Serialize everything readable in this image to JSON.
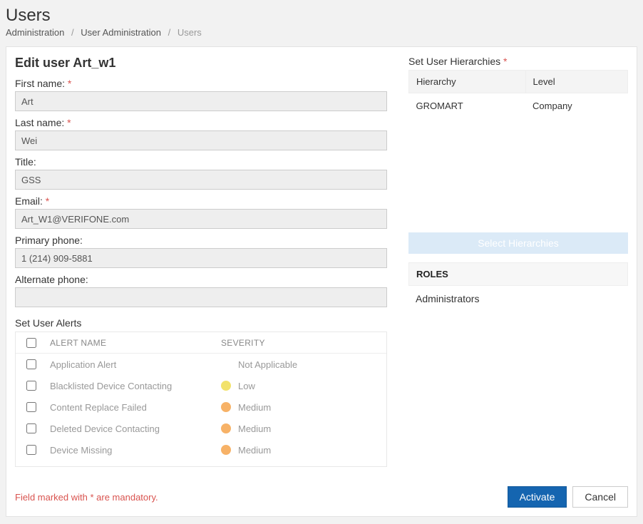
{
  "header": {
    "title": "Users",
    "breadcrumb": {
      "items": [
        "Administration",
        "User Administration",
        "Users"
      ]
    }
  },
  "form": {
    "heading": "Edit user Art_w1",
    "labels": {
      "first_name": "First name:",
      "last_name": "Last name:",
      "title": "Title:",
      "email": "Email:",
      "primary_phone": "Primary phone:",
      "alternate_phone": "Alternate phone:"
    },
    "values": {
      "first_name": "Art",
      "last_name": "Wei",
      "title": "GSS",
      "email": "Art_W1@VERIFONE.com",
      "primary_phone": "1 (214) 909-5881",
      "alternate_phone": ""
    }
  },
  "alerts": {
    "section_label": "Set User Alerts",
    "headers": {
      "name": "ALERT NAME",
      "severity": "SEVERITY"
    },
    "rows": [
      {
        "name": "Application Alert",
        "severity": "Not Applicable",
        "sev_class": "sev-na"
      },
      {
        "name": "Blacklisted Device Contacting",
        "severity": "Low",
        "sev_class": "sev-low"
      },
      {
        "name": "Content Replace Failed",
        "severity": "Medium",
        "sev_class": "sev-medium"
      },
      {
        "name": "Deleted Device Contacting",
        "severity": "Medium",
        "sev_class": "sev-medium"
      },
      {
        "name": "Device Missing",
        "severity": "Medium",
        "sev_class": "sev-medium"
      }
    ]
  },
  "hierarchies": {
    "label": "Set User Hierarchies",
    "columns": {
      "hierarchy": "Hierarchy",
      "level": "Level"
    },
    "rows": [
      {
        "hierarchy": "GROMART",
        "level": "Company"
      }
    ],
    "select_button": "Select Hierarchies"
  },
  "roles": {
    "header": "ROLES",
    "items": [
      "Administrators"
    ]
  },
  "footer": {
    "mandatory_note": "Field marked with * are mandatory.",
    "activate": "Activate",
    "cancel": "Cancel"
  }
}
